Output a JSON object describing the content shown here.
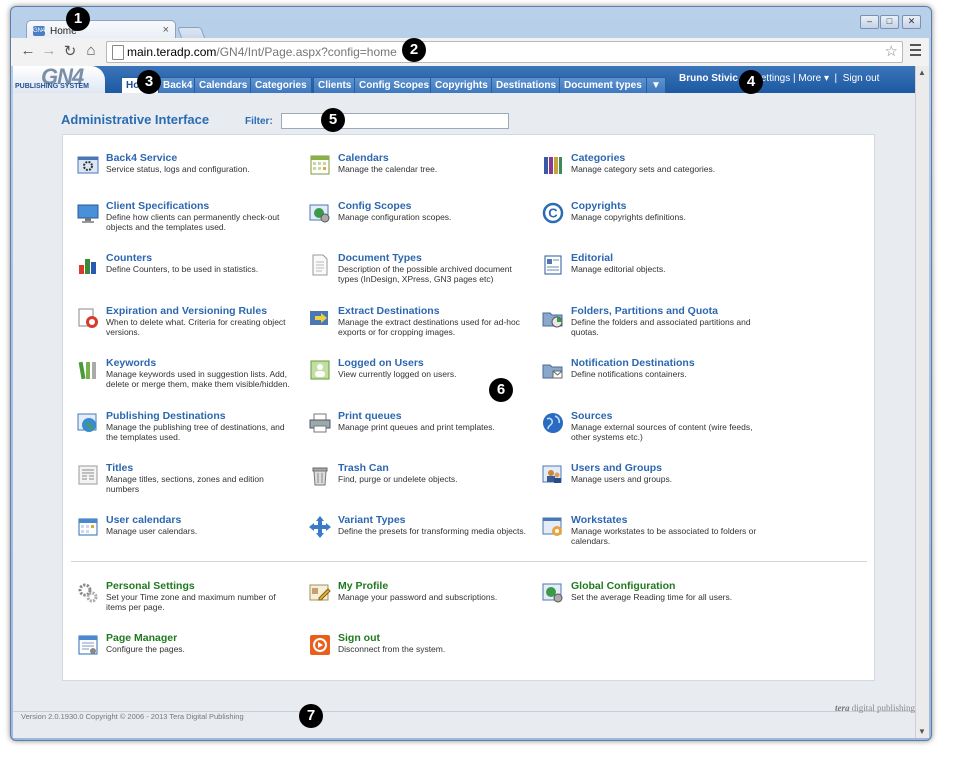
{
  "browser": {
    "tab_title": "Home",
    "favicon": "GN4",
    "tab_close": "×",
    "url_domain": "main.teradp.com",
    "url_path": "/GN4/Int/Page.aspx?config=home",
    "win_min": "–",
    "win_max": "□",
    "win_close": "✕"
  },
  "app": {
    "logo_big": "GN4",
    "logo_small": "PUBLISHING SYSTEM",
    "nav_tabs": [
      {
        "label": "Home",
        "active": true
      },
      {
        "label": "Back4"
      },
      {
        "label": "Calendars"
      },
      {
        "label": "Categories"
      },
      {
        "label": "Clients"
      },
      {
        "label": "Config Scopes"
      },
      {
        "label": "Copyrights"
      },
      {
        "label": "Destinations"
      },
      {
        "label": "Document types"
      },
      {
        "label": "▼"
      }
    ],
    "user_name": "Bruno Stivic",
    "settings_link": "Settings",
    "more_link": "More ▾",
    "signout_link": "Sign out",
    "sep1": "|",
    "sep2": "|",
    "sep3": "|"
  },
  "main": {
    "title": "Administrative Interface",
    "filter_label": "Filter:",
    "filter_value": ""
  },
  "items": [
    {
      "title": "Back4 Service",
      "desc": "Service status, logs and configuration.",
      "icon": "gear-window-icon"
    },
    {
      "title": "Calendars",
      "desc": "Manage the calendar tree.",
      "icon": "calendar-icon"
    },
    {
      "title": "Categories",
      "desc": "Manage category sets and categories.",
      "icon": "books-icon"
    },
    {
      "title": "Client Specifications",
      "desc": "Define how clients can permanently check-out objects and the templates used.",
      "icon": "monitor-icon"
    },
    {
      "title": "Config Scopes",
      "desc": "Manage configuration scopes.",
      "icon": "globe-window-icon"
    },
    {
      "title": "Copyrights",
      "desc": "Manage copyrights definitions.",
      "icon": "copyright-icon"
    },
    {
      "title": "Counters",
      "desc": "Define Counters, to be used in statistics.",
      "icon": "bar-chart-icon"
    },
    {
      "title": "Document Types",
      "desc": "Description of the possible archived document types (InDesign, XPress, GN3 pages etc)",
      "icon": "document-icon"
    },
    {
      "title": "Editorial",
      "desc": "Manage editorial objects.",
      "icon": "editorial-icon"
    },
    {
      "title": "Expiration and Versioning Rules",
      "desc": "When to delete what. Criteria for creating object versions.",
      "icon": "expiration-icon"
    },
    {
      "title": "Extract Destinations",
      "desc": "Manage the extract destinations used for ad-hoc exports or for cropping images.",
      "icon": "export-icon"
    },
    {
      "title": "Folders, Partitions and Quota",
      "desc": "Define the folders and associated partitions and quotas.",
      "icon": "folder-chart-icon"
    },
    {
      "title": "Keywords",
      "desc": "Manage keywords used in suggestion lists. Add, delete or merge them, make them visible/hidden.",
      "icon": "keywords-icon"
    },
    {
      "title": "Logged on Users",
      "desc": "View currently logged on users.",
      "icon": "user-window-icon"
    },
    {
      "title": "Notification Destinations",
      "desc": "Define notifications containers.",
      "icon": "notification-icon"
    },
    {
      "title": "Publishing Destinations",
      "desc": "Manage the publishing tree of destinations, and the templates used.",
      "icon": "globe-icon"
    },
    {
      "title": "Print queues",
      "desc": "Manage print queues and print templates.",
      "icon": "printer-icon"
    },
    {
      "title": "Sources",
      "desc": "Manage external sources of content (wire feeds, other systems etc.)",
      "icon": "earth-icon"
    },
    {
      "title": "Titles",
      "desc": "Manage titles, sections, zones and edition numbers",
      "icon": "titles-icon"
    },
    {
      "title": "Trash Can",
      "desc": "Find, purge or undelete objects.",
      "icon": "trash-icon"
    },
    {
      "title": "Users and Groups",
      "desc": "Manage users and groups.",
      "icon": "users-icon"
    },
    {
      "title": "User calendars",
      "desc": "Manage user calendars.",
      "icon": "user-calendar-icon"
    },
    {
      "title": "Variant Types",
      "desc": "Define the presets for transforming media objects.",
      "icon": "move-arrows-icon"
    },
    {
      "title": "Workstates",
      "desc": "Manage workstates to be associated to folders or calendars.",
      "icon": "workstates-icon"
    }
  ],
  "personal_items": [
    {
      "title": "Personal Settings",
      "desc": "Set your Time zone and maximum number of items per page.",
      "icon": "gears-icon"
    },
    {
      "title": "My Profile",
      "desc": "Manage your password and subscriptions.",
      "icon": "profile-icon"
    },
    {
      "title": "Global Configuration",
      "desc": "Set the average Reading time for all users.",
      "icon": "global-config-icon"
    },
    {
      "title": "Page Manager",
      "desc": "Configure the pages.",
      "icon": "page-manager-icon"
    },
    {
      "title": "Sign out",
      "desc": "Disconnect from the system.",
      "icon": "signout-icon"
    }
  ],
  "footer": {
    "version_text": "Version 2.0.1930.0 Copyright © 2006 - 2013 Tera Digital Publishing",
    "logo_tera": "tera",
    "logo_rest": "digital publishing"
  },
  "markers": [
    "1",
    "2",
    "3",
    "4",
    "5",
    "6",
    "7"
  ],
  "colors": {
    "accent": "#2c67b0",
    "header": "#1d5aa2",
    "green_links": "#1f7a1f",
    "signout": "#e8601c"
  }
}
